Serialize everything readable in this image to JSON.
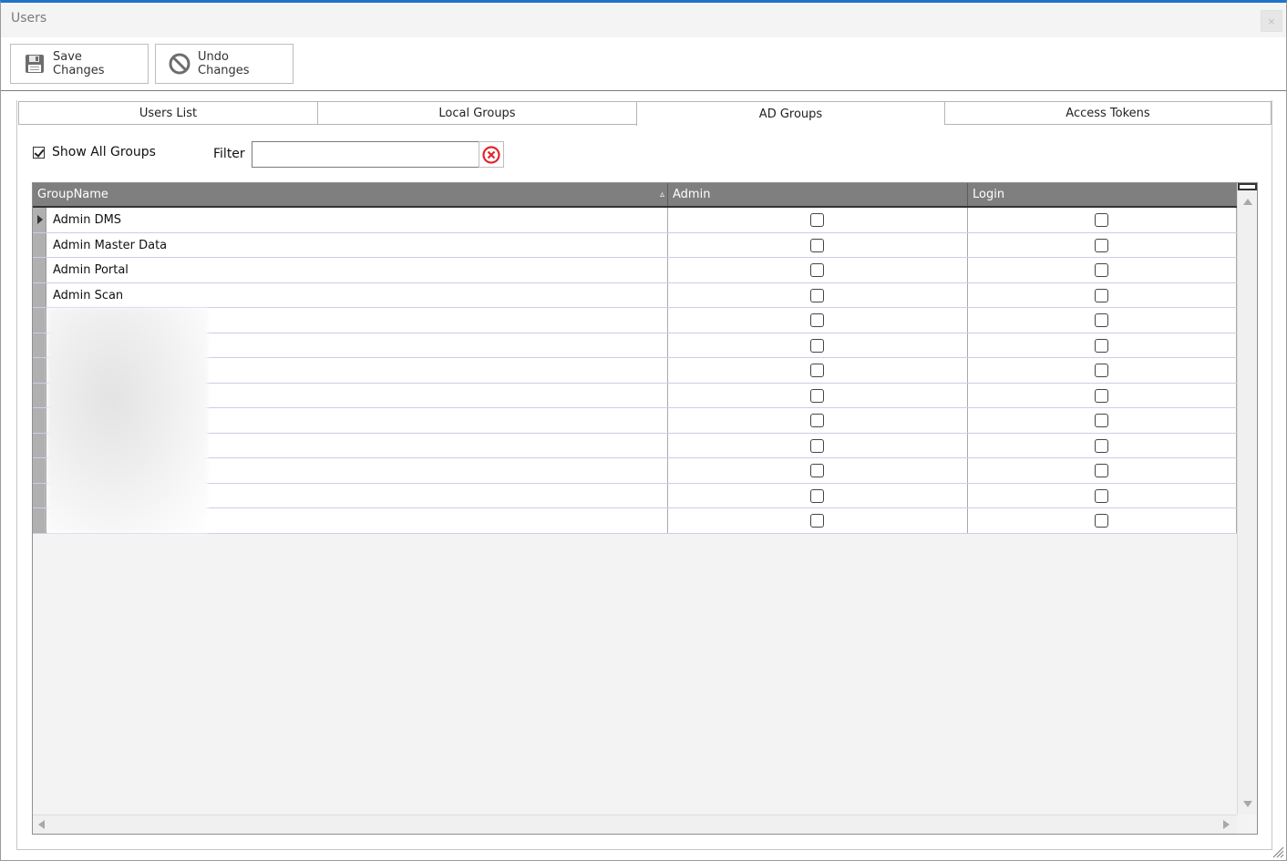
{
  "window": {
    "title": "Users",
    "close_label": "×"
  },
  "toolbar": {
    "save_label": "Save Changes",
    "undo_label": "Undo Changes"
  },
  "tabs": [
    {
      "label": "Users List",
      "active": false
    },
    {
      "label": "Local Groups",
      "active": false
    },
    {
      "label": "AD Groups",
      "active": true
    },
    {
      "label": "Access Tokens",
      "active": false
    }
  ],
  "filters": {
    "show_all_label": "Show All Groups",
    "show_all_checked": true,
    "filter_label": "Filter",
    "filter_value": ""
  },
  "grid": {
    "columns": {
      "group": "GroupName",
      "admin": "Admin",
      "login": "Login"
    },
    "sort_indicator": "▵",
    "rows": [
      {
        "name": "Admin DMS",
        "admin": false,
        "login": false,
        "current": true
      },
      {
        "name": "Admin Master Data",
        "admin": false,
        "login": false
      },
      {
        "name": "Admin Portal",
        "admin": false,
        "login": false
      },
      {
        "name": "Admin Scan",
        "admin": false,
        "login": false
      },
      {
        "name": "",
        "admin": false,
        "login": false
      },
      {
        "name": "",
        "admin": false,
        "login": false
      },
      {
        "name": "",
        "admin": false,
        "login": false
      },
      {
        "name": "",
        "admin": false,
        "login": false
      },
      {
        "name": "",
        "admin": false,
        "login": false
      },
      {
        "name": "",
        "admin": false,
        "login": false
      },
      {
        "name": "",
        "admin": false,
        "login": false
      },
      {
        "name": "",
        "admin": false,
        "login": false
      },
      {
        "name": "",
        "admin": false,
        "login": false
      }
    ]
  },
  "colors": {
    "accent": "#1f73c9",
    "header_bg": "#7f7f7f",
    "clear_icon": "#e0262b"
  },
  "icons": {
    "save": "floppy-disk-icon",
    "undo": "prohibited-circle-icon",
    "clear": "clear-circle-x-icon"
  }
}
